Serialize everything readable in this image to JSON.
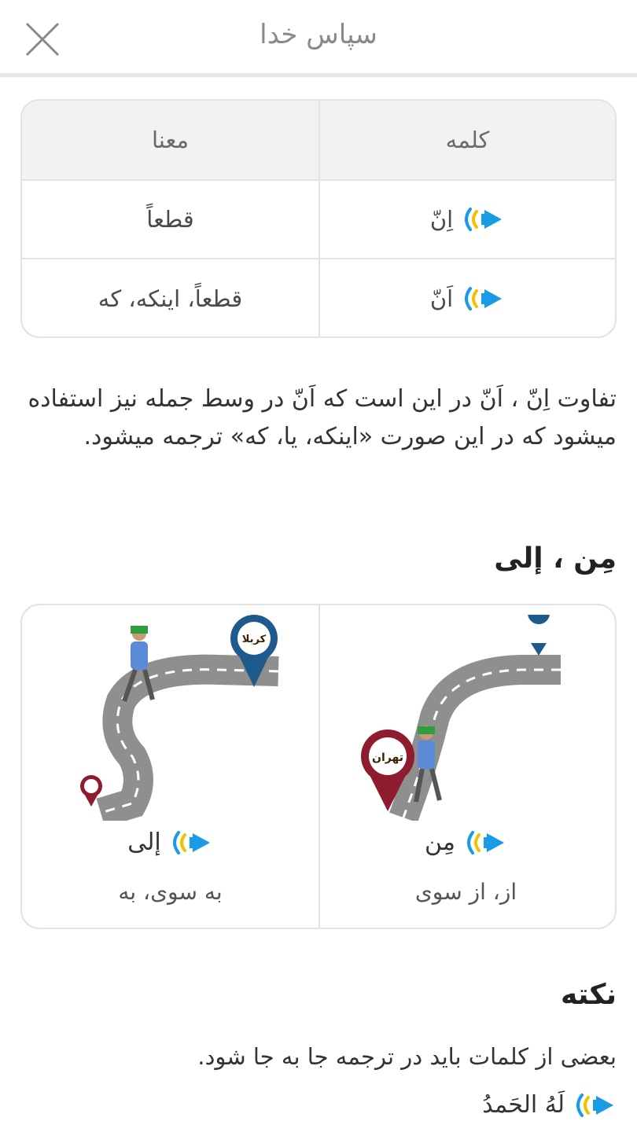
{
  "header": {
    "title": "سپاس خدا"
  },
  "table": {
    "headers": {
      "word": "کلمه",
      "meaning": "معنا"
    },
    "rows": [
      {
        "word": "اِنّ",
        "meaning": "قطعاً"
      },
      {
        "word": "اَنّ",
        "meaning": "قطعاً، اینکه، که"
      }
    ]
  },
  "paragraph": "تفاوت اِنّ ، اَنّ در این است که اَنّ در وسط جمله نیز استفاده میشود که در این صورت «اینکه، یا، که» ترجمه میشود.",
  "section_title": "مِن ، إلی",
  "cards": [
    {
      "word": "مِن",
      "meaning": "از، از سوی",
      "pin_label": "تهران"
    },
    {
      "word": "إلی",
      "meaning": "به سوی، به",
      "pin_label": "کربلا"
    }
  ],
  "note": {
    "title": "نکته",
    "text": "بعضی از کلمات باید در ترجمه جا به جا شود.",
    "example": "لَهُ الحَمدُ"
  },
  "colors": {
    "speaker_blue": "#1a9be6",
    "pin_red": "#8e1b2e",
    "pin_blue": "#1f5a8c",
    "road": "#8f8f8f"
  }
}
